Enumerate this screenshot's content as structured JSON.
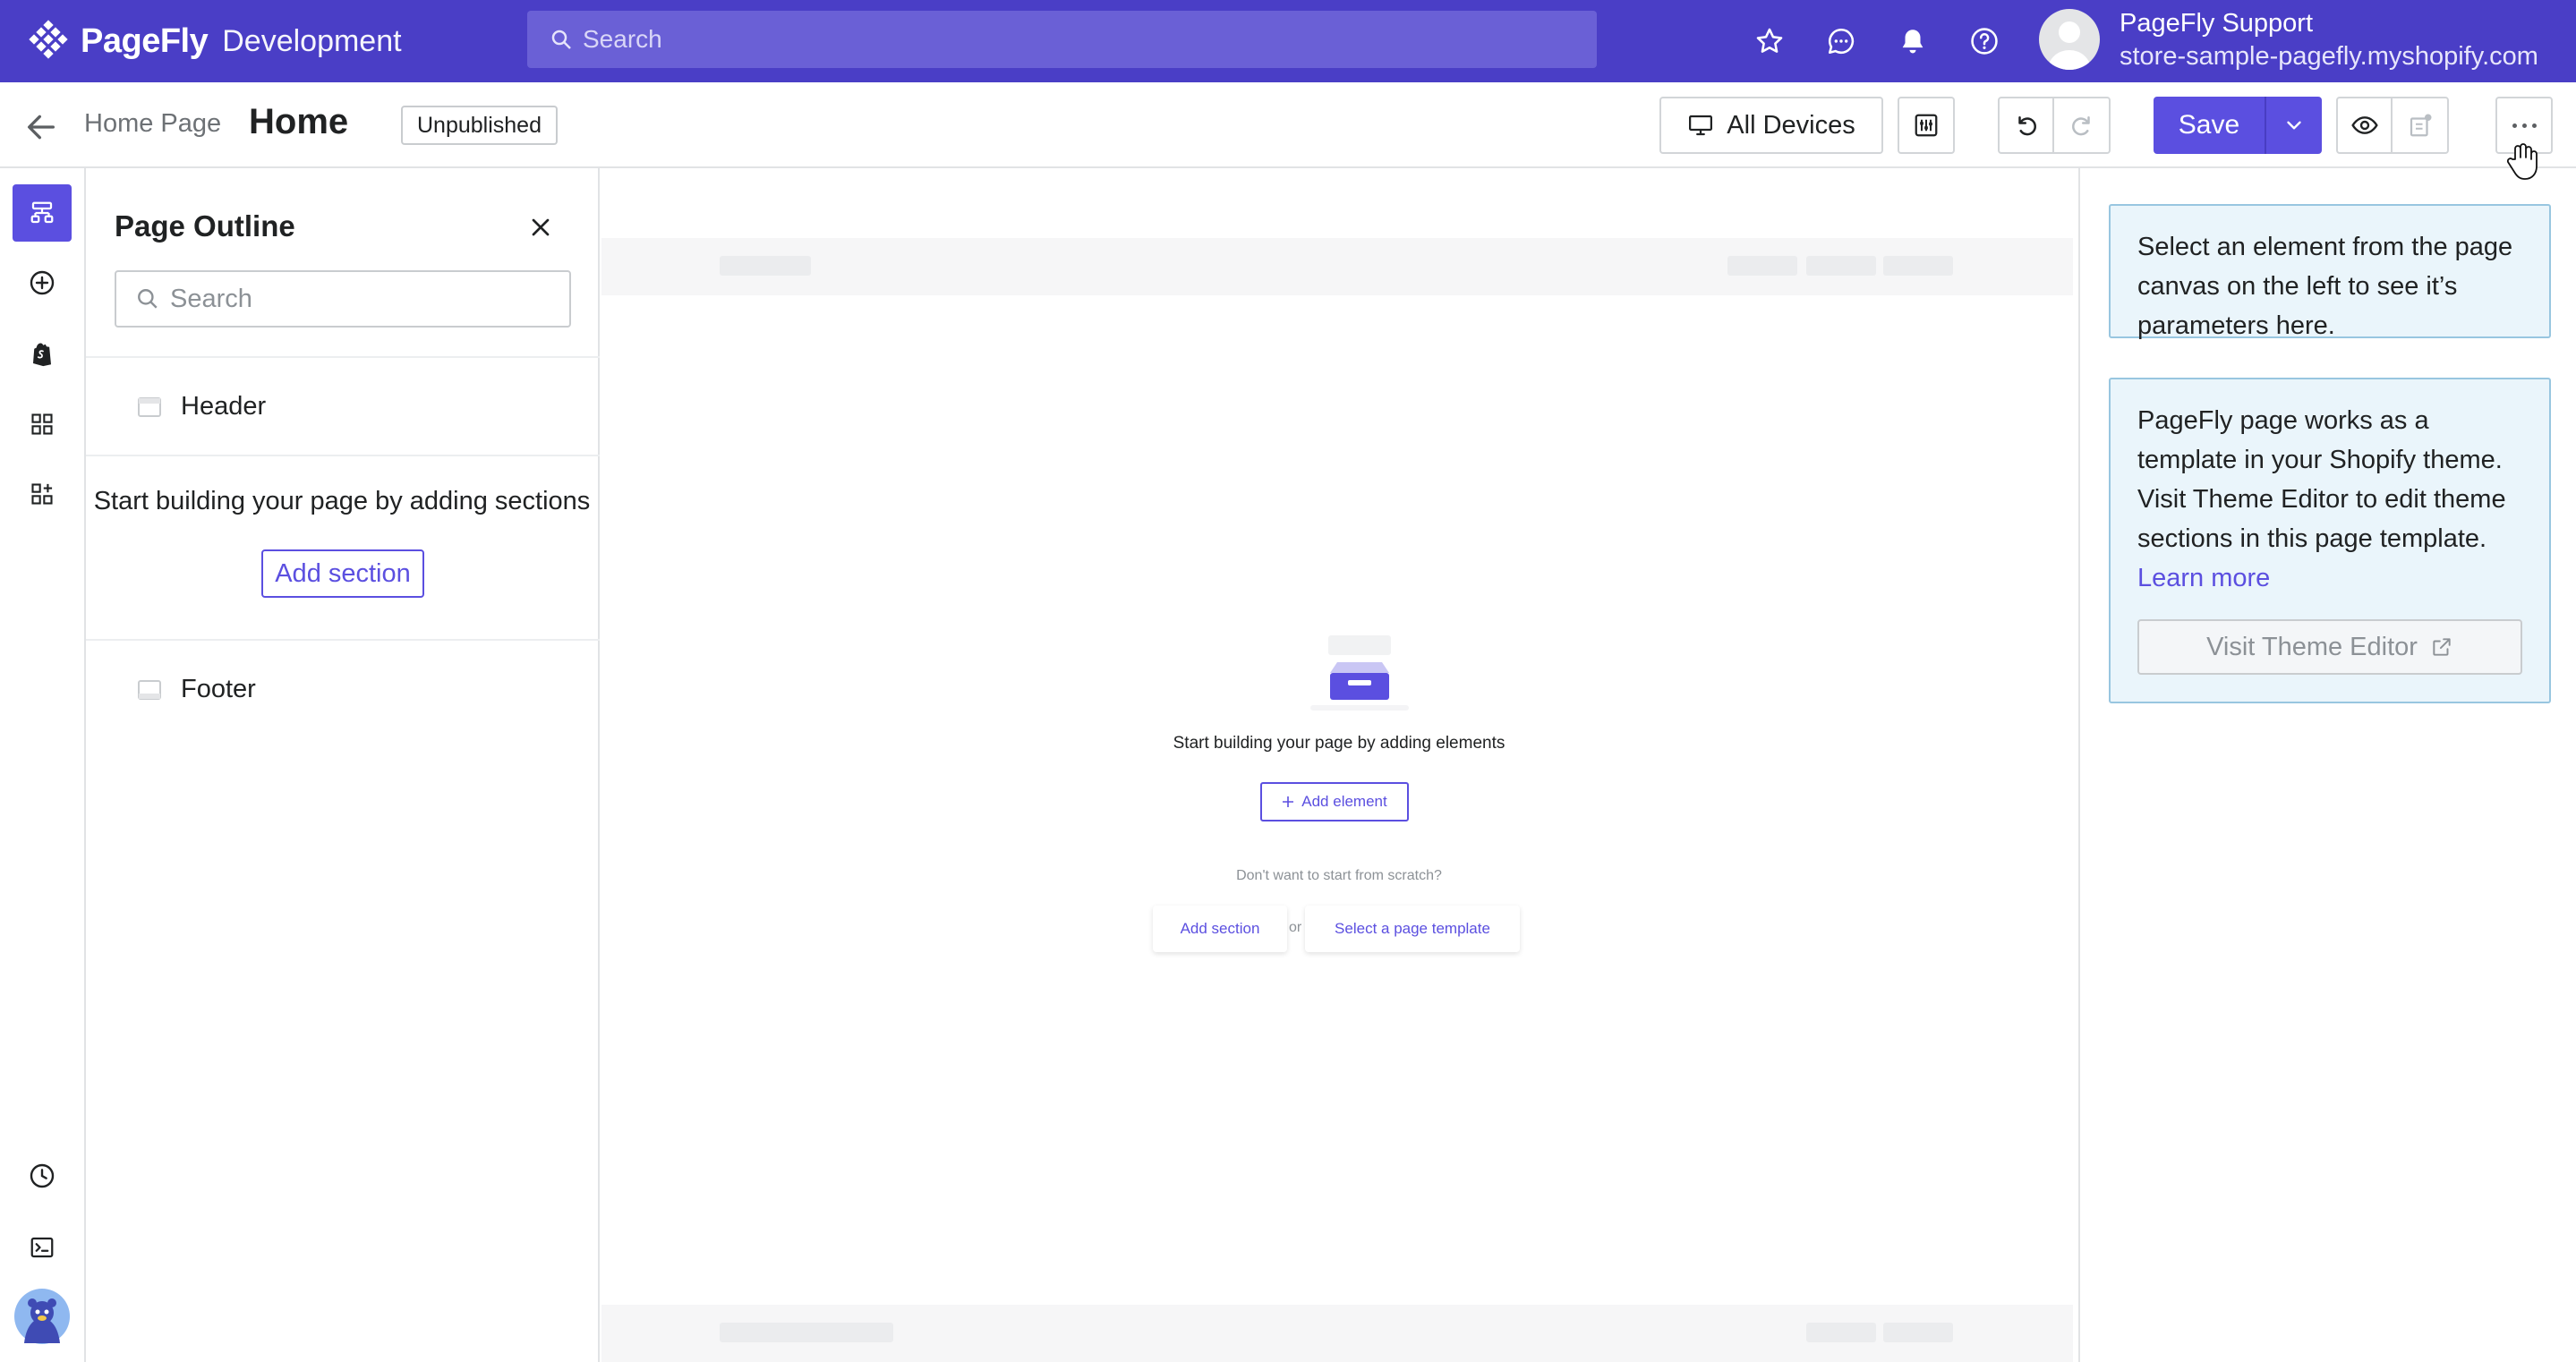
{
  "topbar": {
    "brand_name": "PageFly",
    "brand_env": "Development",
    "search_placeholder": "Search",
    "user_name": "PageFly Support",
    "user_store": "store-sample-pagefly.myshopify.com"
  },
  "toolbar": {
    "breadcrumb": "Home Page",
    "page_title": "Home",
    "status": "Unpublished",
    "devices_label": "All Devices",
    "save_label": "Save"
  },
  "outline": {
    "title": "Page Outline",
    "search_placeholder": "Search",
    "header_label": "Header",
    "empty_message": "Start building your page by adding sections",
    "add_section_label": "Add section",
    "footer_label": "Footer"
  },
  "canvas": {
    "empty_message": "Start building your page by adding elements",
    "add_element_label": "Add element",
    "scratch_message": "Don't want to start from scratch?",
    "add_section_label": "Add section",
    "or_label": "or",
    "template_label": "Select a page template"
  },
  "right_panel": {
    "select_hint": "Select an element from the page canvas on the left to see it’s parameters here.",
    "theme_info": "PageFly page works as a template in your Shopify theme. Visit Theme Editor to edit theme sections in this page template.",
    "learn_more": "Learn more",
    "theme_button": "Visit Theme Editor"
  },
  "colors": {
    "topbar": "#4a3ec6",
    "accent": "#5b4fe0",
    "info_bg": "#eaf5fb"
  },
  "icons": {
    "rail": [
      "outline-icon",
      "add-circle-icon",
      "shopify-bag-icon",
      "grid-icon",
      "apps-icon",
      "history-icon",
      "terminal-icon",
      "mascot-avatar"
    ]
  }
}
